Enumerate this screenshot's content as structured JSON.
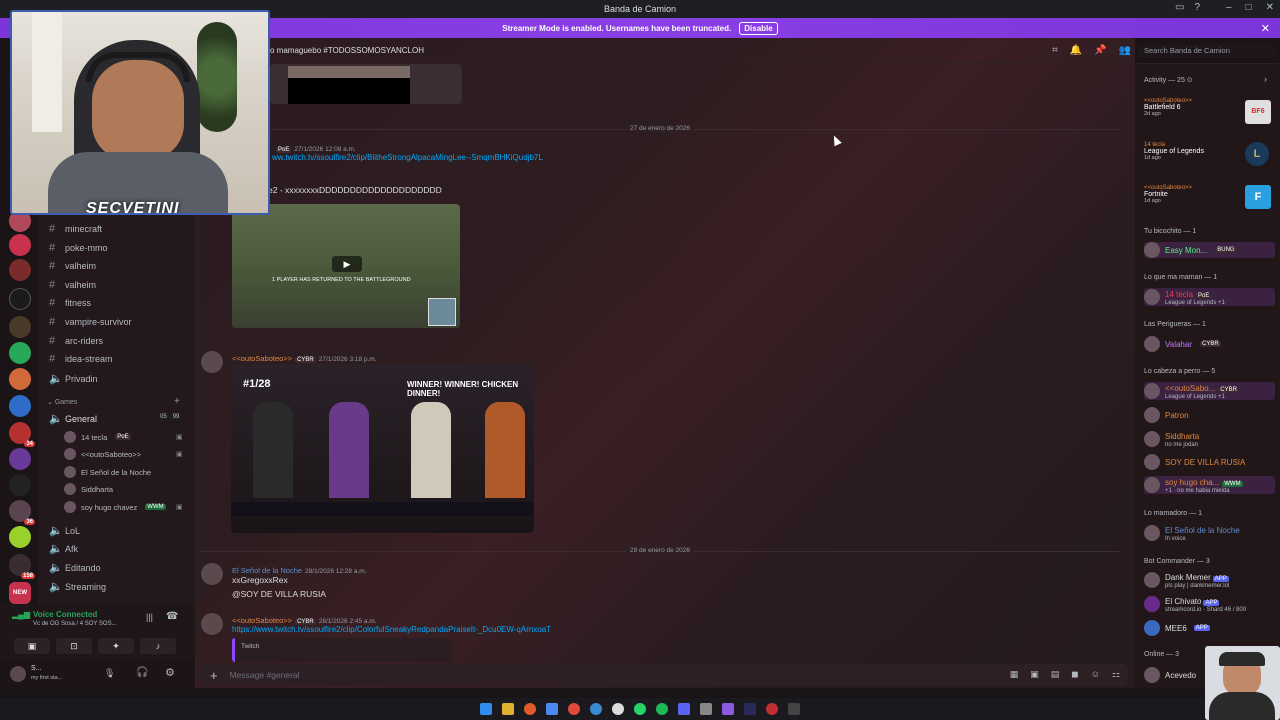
{
  "window": {
    "title": "Banda de Camion"
  },
  "banner": {
    "text": "Streamer Mode is enabled. Usernames have been truncated.",
    "button": "Disable"
  },
  "header": {
    "topic": "o mamaguebo #TODOSSOMOSYANCLOH",
    "search_placeholder": "Search Banda de Camion"
  },
  "webcam": {
    "overlay_text": "SECVETINI"
  },
  "channels": [
    {
      "name": "minecraft",
      "type": "text"
    },
    {
      "name": "poke-mmo",
      "type": "text"
    },
    {
      "name": "valheim",
      "type": "text"
    },
    {
      "name": "valheim",
      "type": "text"
    },
    {
      "name": "fitness",
      "type": "text"
    },
    {
      "name": "vampire-survivor",
      "type": "text"
    },
    {
      "name": "arc-riders",
      "type": "text"
    },
    {
      "name": "idea-stream",
      "type": "text"
    },
    {
      "name": "Privadin",
      "type": "voice"
    }
  ],
  "games_category": "Games",
  "voice_channels": {
    "general": {
      "name": "General",
      "counts": "05",
      "counts2": "99"
    },
    "users": [
      {
        "name": "14 tecla",
        "tag": "PoE"
      },
      {
        "name": "<<outoSaboteo>>",
        "tag": ""
      },
      {
        "name": "El Señol de la Noche",
        "tag": ""
      },
      {
        "name": "Siddharta",
        "tag": ""
      },
      {
        "name": "soy hugo chavez",
        "tag": "WWM"
      }
    ],
    "others": [
      "LoL",
      "Afk",
      "Editando",
      "Streaming"
    ]
  },
  "voice_panel": {
    "status": "Voice Connected",
    "sub": "Vc de OG Sosa / 4 SOY SOS..."
  },
  "user_panel": {
    "name": "S...",
    "status": "my first sta..."
  },
  "messages": {
    "divider1": "27 de enero de 2026",
    "m1": {
      "author": "PoE",
      "ts": "27/1/2026 12:08 a.m.",
      "link": "ww.twitch.tv/ssoulfire2/clip/BlitheStrongAlpacaMingLee--SmqmBHKiQudjb7L",
      "text": "e2 - xxxxxxxxDDDDDDDDDDDDDDDDDDDD"
    },
    "m2": {
      "author": "<<outoSaboteo>>",
      "tag": "CYBR",
      "ts": "27/1/2026 3:18 p.m.",
      "image_title": "WINNER! WINNER! CHICKEN DINNER!",
      "rank": "#1/28",
      "video_caption": "1 PLAYER HAS RETURNED TO THE BATTLEGROUND"
    },
    "divider2": "28 de enero de 2026",
    "m3": {
      "author": "El Señol de la Noche",
      "ts": "28/1/2026 12:28 a.m.",
      "line1": "xxGregoxxRex",
      "line2": "@SOY DE VILLA RUSIA"
    },
    "m4": {
      "author": "<<outoSaboteo>>",
      "tag": "CYBR",
      "ts": "28/1/2026 2:45 a.m.",
      "link": "https://www.twitch.tv/ssoulfire2/clip/ColorfulSneakyRedpandaPraiseIt-_Dcu0EW-qArnxoaT",
      "embed": "Twitch"
    }
  },
  "composer": {
    "placeholder": "Message #general"
  },
  "members": {
    "activity": {
      "label": "Activity — 25",
      "items": [
        {
          "user": "<<outoSaboteo>>",
          "game": "Battlefield 6",
          "ago": "2d ago",
          "badge": "BF6"
        },
        {
          "user": "14 tecla",
          "game": "League of Legends",
          "ago": "1d ago",
          "badge": "L"
        },
        {
          "user": "<<outoSaboteo>>",
          "game": "Fortnite",
          "ago": "1d ago",
          "badge": "F"
        }
      ]
    },
    "groups": [
      {
        "label": "Tu bicochito — 1",
        "members": [
          {
            "name": "Easy Mon...",
            "sub": "",
            "tag": "BUNG",
            "color": "#57f287"
          }
        ]
      },
      {
        "label": "Lo que ma maman — 1",
        "members": [
          {
            "name": "14 tecla",
            "sub": "League of Legends +1",
            "tag": "PoE",
            "color": "#f23f43"
          }
        ]
      },
      {
        "label": "Las Perigueras — 1",
        "members": [
          {
            "name": "Valahar",
            "sub": "",
            "tag": "CYBR",
            "color": "#c27cf7"
          }
        ]
      },
      {
        "label": "Lo cabeza a perro — 5",
        "members": [
          {
            "name": "<<outoSabo...",
            "sub": "League of Legends +1",
            "tag": "CYBR",
            "color": "#e0873e"
          },
          {
            "name": "Patron",
            "sub": "",
            "tag": "",
            "color": "#e0873e"
          },
          {
            "name": "Siddharta",
            "sub": "no me jodan",
            "tag": "",
            "color": "#e0873e"
          },
          {
            "name": "SOY DE VILLA RUSIA",
            "sub": "",
            "tag": "",
            "color": "#e0873e"
          },
          {
            "name": "soy hugo cha...",
            "sub": "+1 · no me habia mielda",
            "tag": "WWM",
            "color": "#e0873e"
          }
        ]
      },
      {
        "label": "Lo mamadoro — 1",
        "members": [
          {
            "name": "El Señol de la Noche",
            "sub": "In voice",
            "tag": "",
            "color": "#5d8fd0"
          }
        ]
      },
      {
        "label": "Bot Commander — 3",
        "members": [
          {
            "name": "Dank Memer",
            "sub": "pls play | dankmemer.lol",
            "tag": "APP",
            "color": "#dbdee1"
          },
          {
            "name": "El Chivato",
            "sub": "streamcord.io · Shard 46 / 800",
            "tag": "APP",
            "color": "#dbdee1"
          },
          {
            "name": "MEE6",
            "sub": "",
            "tag": "APP",
            "color": "#dbdee1"
          }
        ]
      },
      {
        "label": "Online — 3",
        "members": [
          {
            "name": "Acevedo",
            "sub": "",
            "tag": "",
            "color": "#dbdee1"
          }
        ]
      }
    ]
  }
}
